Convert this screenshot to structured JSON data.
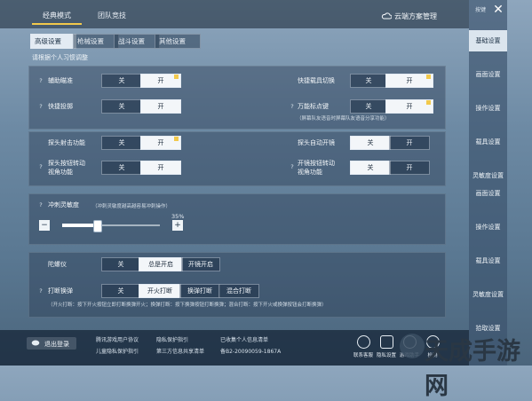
{
  "top_tabs": [
    "经典模式",
    "团队竞技"
  ],
  "cloud_manage": "云端方案管理",
  "sub_tabs": [
    "高级设置",
    "枪械设置",
    "战斗设置",
    "其他设置"
  ],
  "section_hint": "请根据个人习惯调整",
  "toggle_off": "关",
  "toggle_on": "开",
  "group1": {
    "aim_assist": "辅助瞄准",
    "quick_grenade": "快捷投掷",
    "quick_tank": "快捷载具切换",
    "universal_mark": "万能标点键",
    "universal_mark_note": "（屏幕队友语音时屏幕队友语音分享功能）"
  },
  "group2": {
    "peek_fire": "探头射击功能",
    "auto_peek": "探头自动开镜",
    "peek_view_1": "探头按钮转动",
    "peek_view_2": "视角功能",
    "scope_view_1": "开镜按钮转动",
    "scope_view_2": "视角功能"
  },
  "sprint": {
    "label": "冲刺灵敏度",
    "note": "（冲刺灵敏度越高越容易冲刺操作）",
    "value_label": "35%",
    "value": 35,
    "minus": "−",
    "plus": "+"
  },
  "gyro": {
    "label": "陀螺仪",
    "options": [
      "关",
      "总是开启",
      "开镜开启"
    ]
  },
  "interrupt": {
    "label": "打断换弹",
    "options": [
      "关",
      "开火打断",
      "换弹打断",
      "混合打断"
    ],
    "note": "（开火打断：按下开火按钮立即打断换弹开火；换弹打断：按下换弹按钮打断换弹；混合打断：按下开火或换弹按钮会打断换弹）"
  },
  "right_bar": {
    "close": "✕",
    "item_top": "按键",
    "items": [
      "基础设置",
      "画面设置",
      "操作设置",
      "载具设置",
      "灵敏度设置",
      "画面设置",
      "操作设置",
      "载具设置",
      "灵敏度设置",
      "拾取设置"
    ]
  },
  "bottom": {
    "logout": "退出登录",
    "links": [
      "腾讯游戏用户协议",
      "隐私保护指引",
      "已收集个人信息清单",
      "儿童隐私保护指引",
      "第三方信息共享清单",
      "备B2-20090059-1867A"
    ],
    "icons": [
      "联系客服",
      "隐私设置",
      "游戏助手",
      "检测"
    ]
  },
  "watermark": "天成手游网",
  "colors": {
    "accent": "#f2c94c",
    "active_bg": "#f3f6f9",
    "panel": "#2c4058"
  }
}
